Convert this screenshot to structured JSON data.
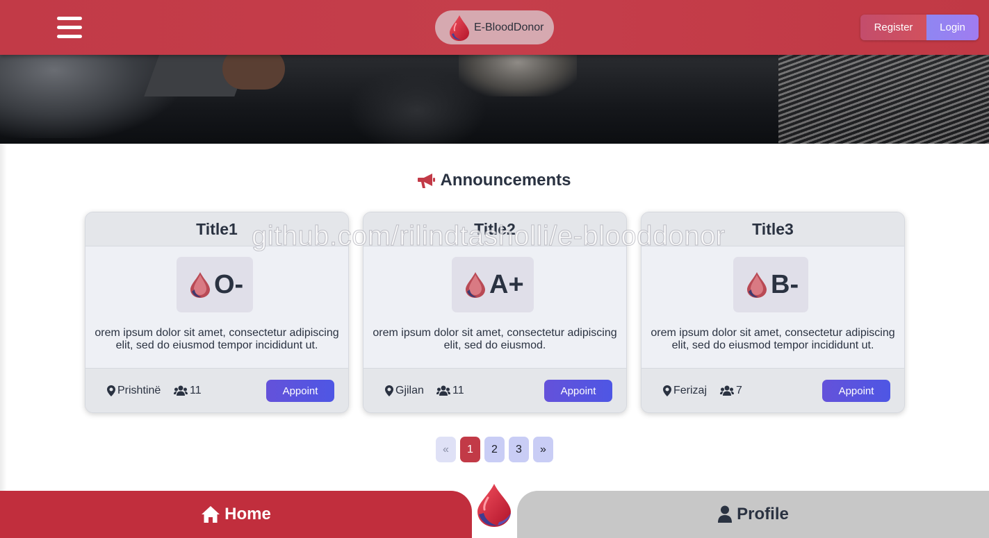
{
  "navbar": {
    "brand": "E-BloodDonor",
    "register_label": "Register",
    "login_label": "Login"
  },
  "announcements": {
    "heading": "Announcements",
    "cards": [
      {
        "title": "Title1",
        "blood_type": "O-",
        "description": "orem ipsum dolor sit amet, consectetur adipiscing elit, sed do eiusmod tempor incididunt ut.",
        "location": "Prishtinë",
        "people": "11",
        "button": "Appoint"
      },
      {
        "title": "Title2",
        "blood_type": "A+",
        "description": "orem ipsum dolor sit amet, consectetur adipiscing elit, sed do eiusmod.",
        "location": "Gjilan",
        "people": "11",
        "button": "Appoint"
      },
      {
        "title": "Title3",
        "blood_type": "B-",
        "description": "orem ipsum dolor sit amet, consectetur adipiscing elit, sed do eiusmod tempor incididunt ut.",
        "location": "Ferizaj",
        "people": "7",
        "button": "Appoint"
      }
    ]
  },
  "watermark": "github.com/rilindtasholli/e-blooddonor",
  "pagination": {
    "prev": "«",
    "pages": [
      "1",
      "2",
      "3"
    ],
    "active_page": "1",
    "next": "»"
  },
  "bottom_nav": {
    "home_label": "Home",
    "profile_label": "Profile"
  },
  "colors": {
    "primary": "#c23a47",
    "appoint": "#5a55df",
    "login": "#9580f1"
  }
}
